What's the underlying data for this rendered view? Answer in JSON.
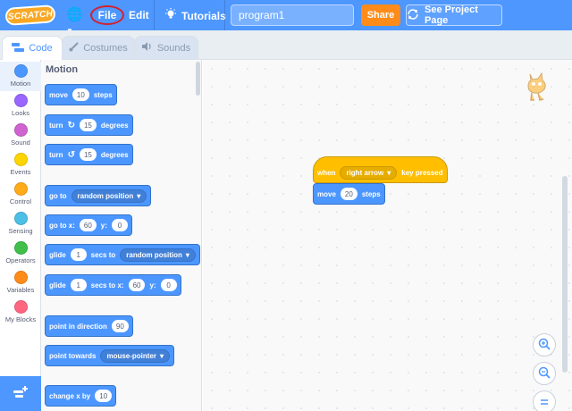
{
  "menubar": {
    "logo_text": "SCRATCH",
    "file_label": "File",
    "edit_label": "Edit",
    "tutorials_label": "Tutorials",
    "project_title": "program1",
    "share_label": "Share",
    "see_project_label": "See Project Page"
  },
  "tabs": [
    {
      "label": "Code",
      "icon": "code-icon",
      "active": true
    },
    {
      "label": "Costumes",
      "icon": "brush-icon",
      "active": false
    },
    {
      "label": "Sounds",
      "icon": "speaker-icon",
      "active": false
    }
  ],
  "categories": [
    {
      "label": "Motion",
      "color": "#4c97ff",
      "selected": true
    },
    {
      "label": "Looks",
      "color": "#9966ff"
    },
    {
      "label": "Sound",
      "color": "#cf63cf"
    },
    {
      "label": "Events",
      "color": "#ffd500"
    },
    {
      "label": "Control",
      "color": "#ffab19"
    },
    {
      "label": "Sensing",
      "color": "#4cbfe6"
    },
    {
      "label": "Operators",
      "color": "#40bf4a"
    },
    {
      "label": "Variables",
      "color": "#ff8c1a"
    },
    {
      "label": "My Blocks",
      "color": "#ff6680"
    }
  ],
  "palette": {
    "title": "Motion",
    "blocks": {
      "move": {
        "pre": "move",
        "value": "10",
        "post": "steps"
      },
      "turn_right": {
        "pre": "turn",
        "value": "15",
        "post": "degrees"
      },
      "turn_left": {
        "pre": "turn",
        "value": "15",
        "post": "degrees"
      },
      "goto": {
        "pre": "go to",
        "menu": "random position"
      },
      "goto_xy": {
        "pre": "go to x:",
        "x": "60",
        "mid": "y:",
        "y": "0"
      },
      "glide_to": {
        "pre": "glide",
        "value": "1",
        "mid": "secs to",
        "menu": "random position"
      },
      "glide_xy": {
        "pre": "glide",
        "value": "1",
        "mid": "secs to x:",
        "x": "60",
        "mid2": "y:",
        "y": "0"
      },
      "point_dir": {
        "pre": "point in direction",
        "value": "90"
      },
      "point_towards": {
        "pre": "point towards",
        "menu": "mouse-pointer"
      },
      "change_x": {
        "pre": "change x by",
        "value": "10"
      }
    }
  },
  "workspace": {
    "hat": {
      "pre": "when",
      "menu": "right arrow",
      "post": "key pressed"
    },
    "move": {
      "pre": "move",
      "value": "20",
      "post": "steps"
    }
  },
  "colors": {
    "accent": "#4d97ff",
    "share": "#ff8c1a",
    "event": "#ffbf00",
    "motion": "#4c97ff",
    "highlight": "#d4202f"
  }
}
